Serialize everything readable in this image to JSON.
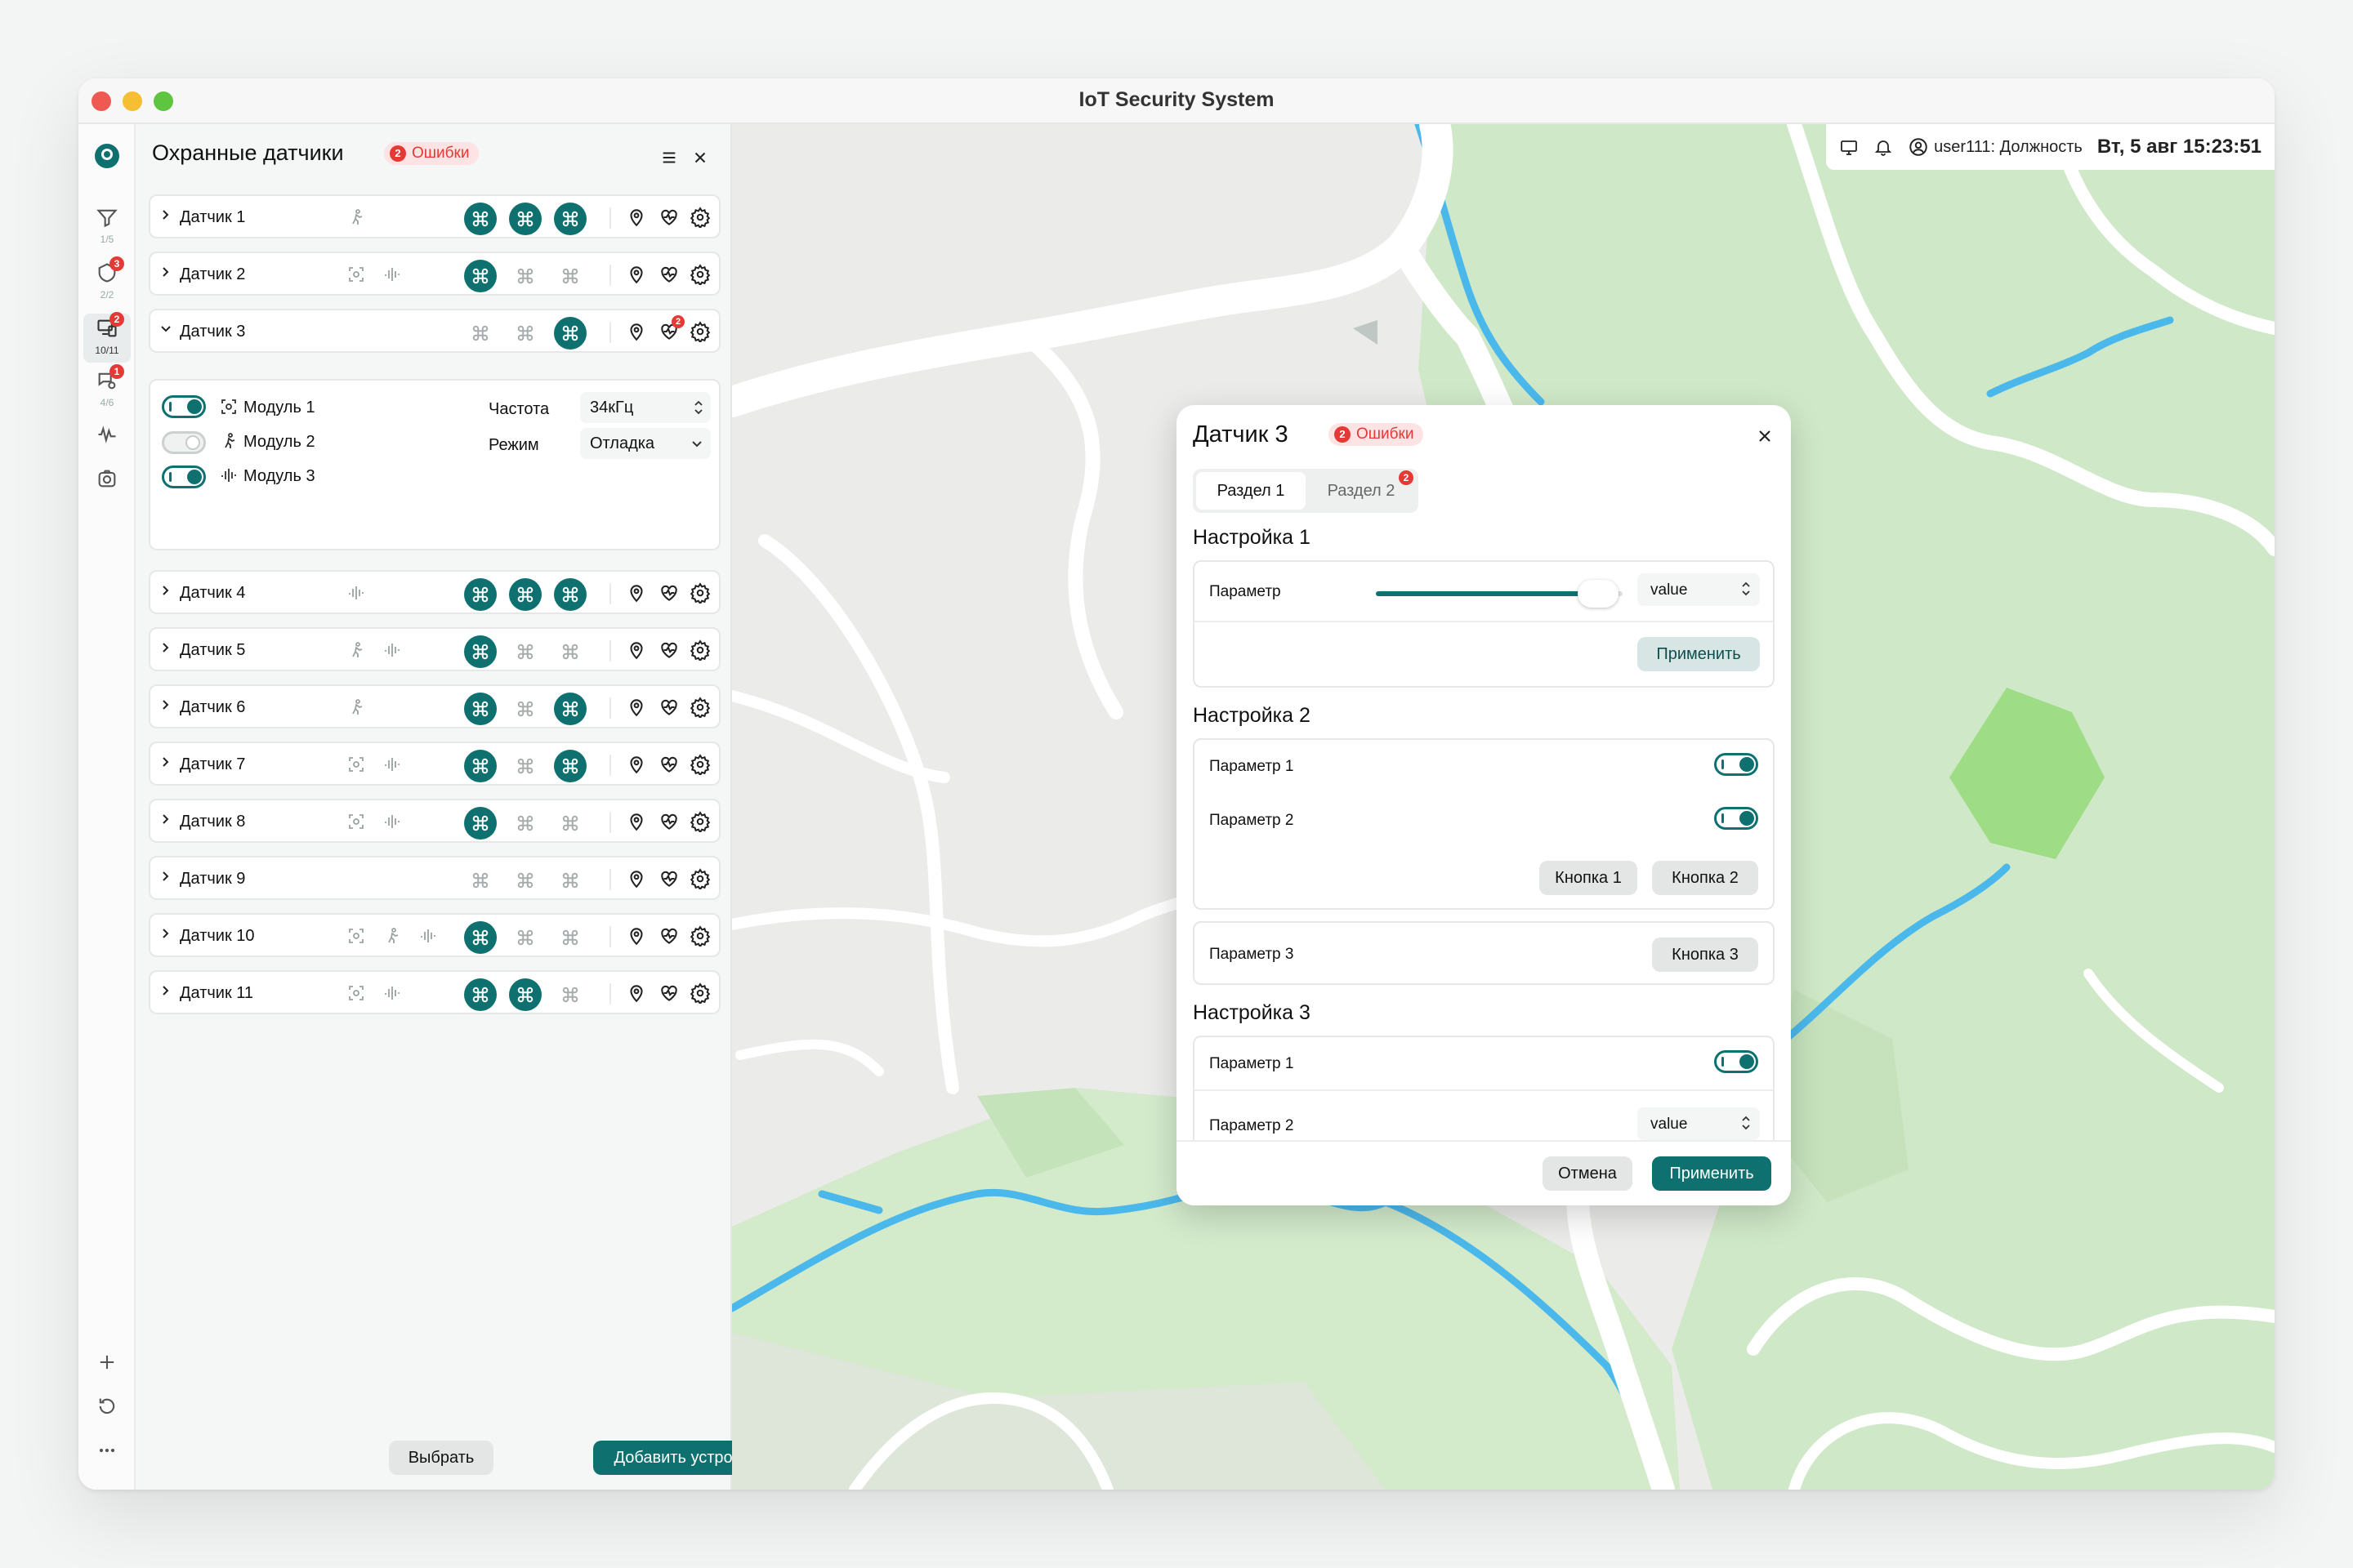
{
  "window": {
    "title": "IoT Security System"
  },
  "rail": {
    "items": [
      {
        "icon": "filter-icon",
        "sub": "1/5",
        "badge": ""
      },
      {
        "icon": "shield-icon",
        "sub": "2/2",
        "badge": "3"
      },
      {
        "icon": "devices-icon",
        "sub": "10/11",
        "badge": "2"
      },
      {
        "icon": "sensor-chat-icon",
        "sub": "4/6",
        "badge": "1"
      },
      {
        "icon": "waveform-icon",
        "sub": "",
        "badge": ""
      },
      {
        "icon": "camera-icon",
        "sub": "",
        "badge": ""
      }
    ]
  },
  "sidebar": {
    "title": "Охранные датчики",
    "errors_label": "Ошибки",
    "errors_count": "2",
    "sensors": [
      {
        "name": "Датчик 1",
        "caps": [
          "motion"
        ],
        "cmds": [
          1,
          1,
          1
        ]
      },
      {
        "name": "Датчик 2",
        "caps": [
          "scan",
          "wave"
        ],
        "cmds": [
          1,
          0,
          0
        ]
      },
      {
        "name": "Датчик 3",
        "caps": [],
        "cmds": [
          0,
          0,
          1
        ],
        "expanded": true,
        "alert": "2"
      },
      {
        "name": "Датчик 4",
        "caps": [
          "wave"
        ],
        "cmds": [
          1,
          1,
          1
        ]
      },
      {
        "name": "Датчик 5",
        "caps": [
          "motion",
          "wave"
        ],
        "cmds": [
          1,
          0,
          0
        ]
      },
      {
        "name": "Датчик 6",
        "caps": [
          "motion"
        ],
        "cmds": [
          1,
          0,
          1
        ]
      },
      {
        "name": "Датчик 7",
        "caps": [
          "scan",
          "wave"
        ],
        "cmds": [
          1,
          0,
          1
        ]
      },
      {
        "name": "Датчик 8",
        "caps": [
          "scan",
          "wave"
        ],
        "cmds": [
          1,
          0,
          0
        ]
      },
      {
        "name": "Датчик 9",
        "caps": [],
        "cmds": [
          0,
          0,
          0
        ]
      },
      {
        "name": "Датчик 10",
        "caps": [
          "scan",
          "motion",
          "wave"
        ],
        "cmds": [
          1,
          0,
          0
        ]
      },
      {
        "name": "Датчик 11",
        "caps": [
          "scan",
          "wave"
        ],
        "cmds": [
          1,
          1,
          0
        ]
      }
    ],
    "expanded": {
      "modules": [
        {
          "label": "Модуль 1",
          "on": true
        },
        {
          "label": "Модуль 2",
          "on": false
        },
        {
          "label": "Модуль 3",
          "on": true
        }
      ],
      "freq_label": "Частота",
      "freq_value": "34кГц",
      "mode_label": "Режим",
      "mode_value": "Отладка"
    },
    "select_button": "Выбрать",
    "add_button": "Добавить устройство"
  },
  "topbar": {
    "user": "user111: Должность",
    "datetime": "Вт, 5 авг 15:23:51"
  },
  "modal": {
    "title": "Датчик 3",
    "errors_label": "Ошибки",
    "errors_count": "2",
    "tabs": [
      {
        "label": "Раздел 1"
      },
      {
        "label": "Раздел 2",
        "badge": "2"
      }
    ],
    "section1": {
      "title": "Настройка 1",
      "param_label": "Параметр",
      "slider_value": 0.9,
      "stepper_value": "value",
      "apply": "Применить"
    },
    "section2": {
      "title": "Настройка 2",
      "param1": "Параметр 1",
      "param2": "Параметр 2",
      "button1": "Кнопка 1",
      "button2": "Кнопка 2",
      "param3": "Параметр 3",
      "button3": "Кнопка 3"
    },
    "section3": {
      "title": "Настройка 3",
      "param1": "Параметр 1",
      "param2": "Параметр 2",
      "stepper_value": "value"
    },
    "cancel": "Отмена",
    "apply": "Применить"
  },
  "colors": {
    "accent": "#0e7170",
    "error": "#e53935",
    "map_green": "#cde8c4",
    "water": "#4bb8ec"
  }
}
